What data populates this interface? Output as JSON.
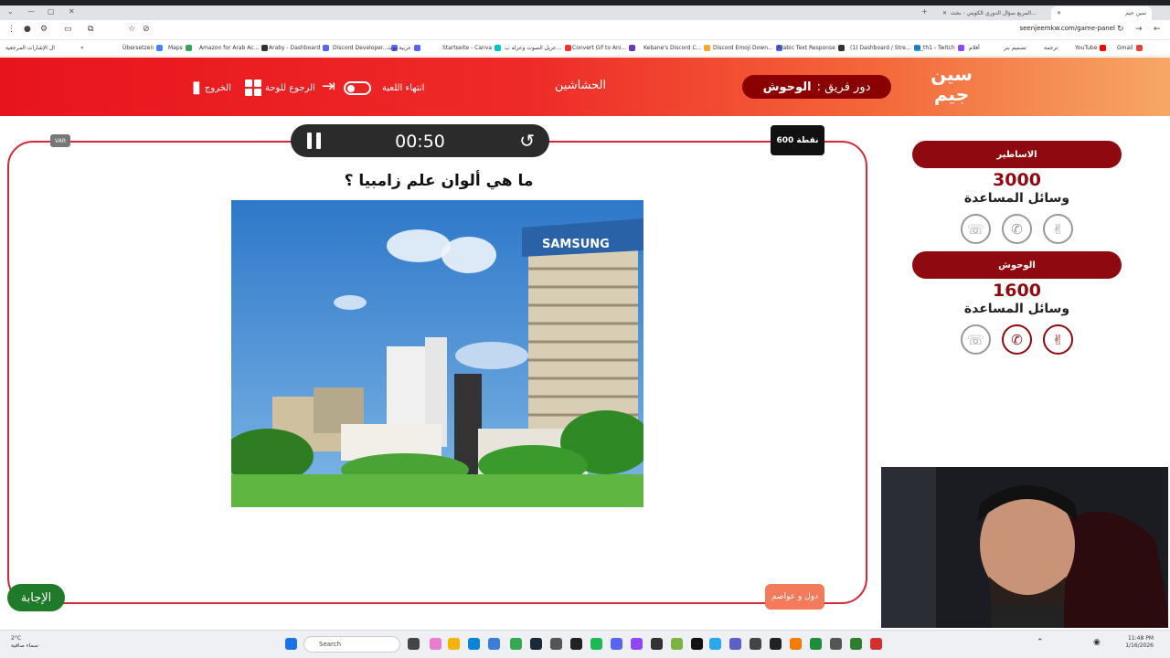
{
  "browser": {
    "tabs": [
      {
        "label": "سين جيم",
        "active": false
      },
      {
        "label": "المربع سؤال الدوري الكويتي - بحث...",
        "active": true
      }
    ],
    "url": "seenjeemkw.com/game-panel",
    "bookmarks": [
      "ال الإشارات المرجعية",
      "Übersetzen",
      "Maps",
      "Amazon for Arab Ac...",
      "Araby - Dashboard",
      "Discord Developer...",
      "عربية بوت",
      "Startseite - Canva",
      "عزيل الصوت وعزله ب...",
      "Convert Gif to Ani...",
      "Kebane's Discord C...",
      "Discord Emoji Down...",
      "Arabic Text Response",
      "(1) Dashboard / Stre...",
      "ilo_th1 - Twitch",
      "أفلام",
      "تصميم بنر",
      "ترجمة",
      "YouTube",
      "Gmail"
    ]
  },
  "header": {
    "logo_line1": "سين",
    "logo_line2": "جيم",
    "turn_prefix": "دور فريق :",
    "turn_team": "الوحوش",
    "center_title": "الحشاشين",
    "end_game": "انتهاء اللعبة",
    "back_to_board": "الرجوع للوحة",
    "exit": "الخروج"
  },
  "game": {
    "timer": "00:50",
    "points": "600 نقطة",
    "mini_badge": "VAR",
    "question": "ما هي ألوان علم زامبيا ؟",
    "answer_button": "الإجابة",
    "category": "دول و عواصم"
  },
  "teams": [
    {
      "name": "الاساطير",
      "score": "3000",
      "aids_label": "وسائل المساعدة"
    },
    {
      "name": "الوحوش",
      "score": "1600",
      "aids_label": "وسائل المساعدة"
    }
  ],
  "taskbar": {
    "search_placeholder": "Search",
    "weather_temp": "2°C",
    "weather_desc": "سماء صافية",
    "time": "11:48 PM",
    "date": "1/16/2026"
  },
  "colors": {
    "brand_red": "#e8141c",
    "dark_red": "#8e0a10",
    "answer_green": "#1f7a2a"
  }
}
